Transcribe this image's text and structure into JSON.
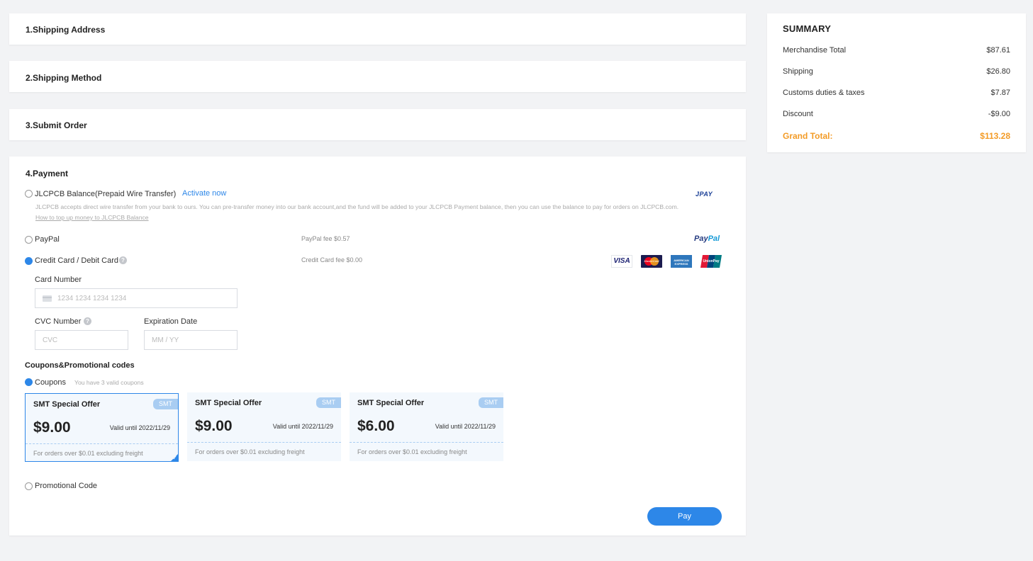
{
  "steps": {
    "shipping_address": "1.Shipping Address",
    "shipping_method": "2.Shipping Method",
    "submit_order": "3.Submit Order",
    "payment": "4.Payment"
  },
  "payment": {
    "balance": {
      "label": "JLCPCB Balance(Prepaid Wire Transfer)",
      "activate": "Activate now",
      "logo": "JPAY",
      "description": "JLCPCB accepts direct wire transfer from your bank to ours. You can pre-transfer money into our bank account,and the fund will be added to your JLCPCB Payment balance, then you can use the balance to pay for orders on JLCPCB.com.",
      "help_link": "How to top up money to JLCPCB Balance"
    },
    "paypal": {
      "label": "PayPal",
      "fee": "PayPal fee $0.57",
      "logo_part1": "Pay",
      "logo_part2": "Pal"
    },
    "card": {
      "label": "Credit Card / Debit Card",
      "fee": "Credit Card fee $0.00",
      "help_glyph": "?",
      "card_number_label": "Card Number",
      "card_number_placeholder": "1234 1234 1234 1234",
      "cvc_label": "CVC Number",
      "cvc_placeholder": "CVC",
      "expiry_label": "Expiration Date",
      "expiry_placeholder": "MM / YY",
      "logos": {
        "visa": "VISA",
        "mastercard": "MasterCard",
        "amex": "AMERICAN EXPRESS",
        "unionpay": "UnionPay"
      }
    },
    "coupons_title": "Coupons&Promotional codes",
    "coupons_label": "Coupons",
    "coupons_hint": "You have 3 valid coupons",
    "coupons": [
      {
        "title": "SMT Special Offer",
        "tag": "SMT",
        "amount": "$9.00",
        "valid": "Valid until 2022/11/29",
        "condition": "For orders over $0.01 excluding freight"
      },
      {
        "title": "SMT Special Offer",
        "tag": "SMT",
        "amount": "$9.00",
        "valid": "Valid until 2022/11/29",
        "condition": "For orders over $0.01 excluding freight"
      },
      {
        "title": "SMT Special Offer",
        "tag": "SMT",
        "amount": "$6.00",
        "valid": "Valid until 2022/11/29",
        "condition": "For orders over $0.01 excluding freight"
      }
    ],
    "promo_label": "Promotional Code",
    "pay_button": "Pay"
  },
  "summary": {
    "title": "SUMMARY",
    "rows": [
      {
        "label": "Merchandise Total",
        "value": "$87.61"
      },
      {
        "label": "Shipping",
        "value": "$26.80"
      },
      {
        "label": "Customs duties & taxes",
        "value": "$7.87"
      },
      {
        "label": "Discount",
        "value": "-$9.00"
      }
    ],
    "grand_label": "Grand Total:",
    "grand_value": "$113.28"
  },
  "colors": {
    "accent": "#2d87e8",
    "grand_total": "#f39b26",
    "background": "#f2f3f5"
  }
}
